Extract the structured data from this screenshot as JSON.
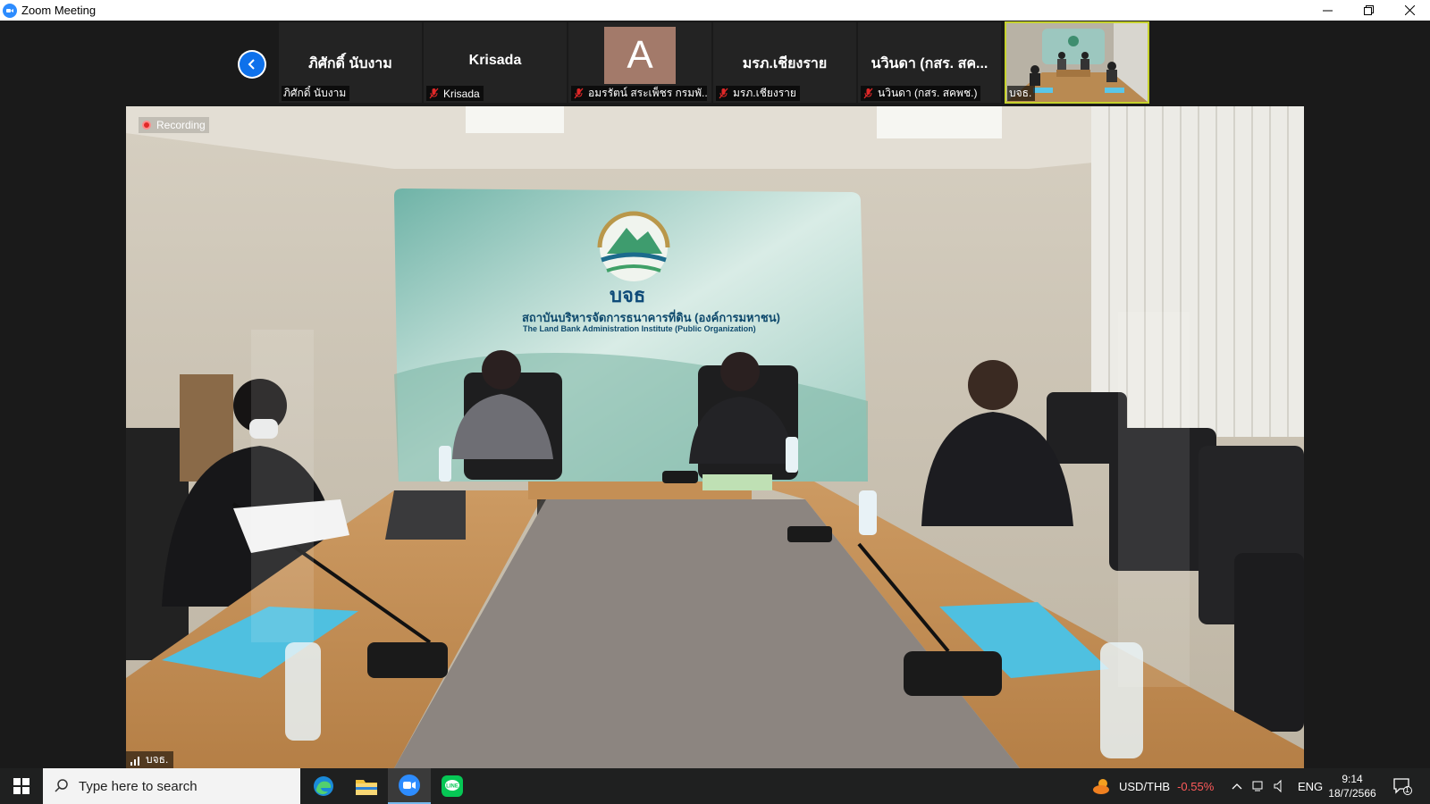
{
  "window": {
    "title": "Zoom Meeting",
    "controls": [
      "minimize-icon",
      "restore-icon",
      "close-icon"
    ]
  },
  "gallery": {
    "prev_icon": "chevron-left-icon",
    "tiles": [
      {
        "display_name": "ภิศักดิ์ นับงาม",
        "label": "ภิศักดิ์ นับงาม",
        "muted": false
      },
      {
        "display_name": "Krisada",
        "label": "Krisada",
        "muted": true
      },
      {
        "avatar_letter": "A",
        "label": "อมรรัตน์ สระเพ็ชร กรมพั...",
        "muted": true
      },
      {
        "display_name": "มรภ.เชียงราย",
        "label": "มรภ.เชียงราย",
        "muted": true
      },
      {
        "display_name": "นวินดา (กสร. สค...",
        "label": "นวินดา (กสร. สคพช.)",
        "muted": true
      },
      {
        "label": "บจธ.",
        "muted": true,
        "video": true,
        "active": true
      }
    ]
  },
  "main_video": {
    "recording_label": "Recording",
    "participant_label": "บจธ.",
    "backdrop": {
      "abbr": "บจธ",
      "name_th": "สถาบันบริหารจัดการธนาคารที่ดิน (องค์การมหาชน)",
      "name_en": "The Land Bank Administration Institute (Public Organization)"
    }
  },
  "taskbar": {
    "search_placeholder": "Type here to search",
    "apps": [
      "edge-icon",
      "file-explorer-icon",
      "zoom-icon",
      "line-icon"
    ],
    "ticker_label": "USD/THB",
    "ticker_value": "-0.55%",
    "ticker_color": "#ff5a5a",
    "language": "ENG",
    "time": "9:14",
    "date": "18/7/2566",
    "notification_count": "1"
  },
  "colors": {
    "zoom_blue": "#2d8cff",
    "active_tile_border": "#c6d22d",
    "recording_red": "#e02828"
  }
}
